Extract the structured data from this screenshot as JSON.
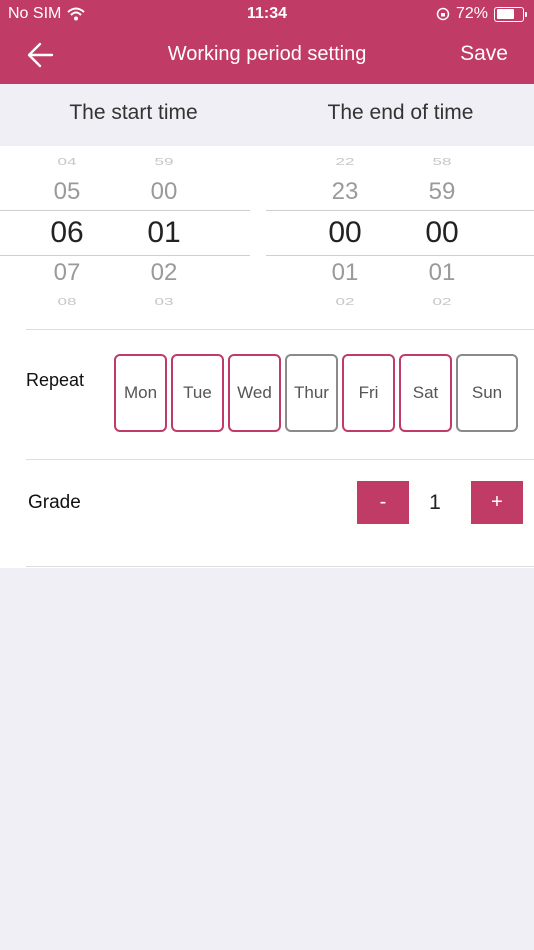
{
  "status": {
    "carrier": "No SIM",
    "time": "11:34",
    "battery": "72%",
    "battery_level": 0.72
  },
  "nav": {
    "title": "Working period setting",
    "save": "Save"
  },
  "time_header": {
    "start": "The start time",
    "end": "The end of time"
  },
  "start_time": {
    "hours": [
      "04",
      "05",
      "06",
      "07",
      "08"
    ],
    "minutes": [
      "59",
      "00",
      "01",
      "02",
      "03"
    ]
  },
  "end_time": {
    "hours": [
      "22",
      "23",
      "00",
      "01",
      "02"
    ],
    "minutes": [
      "58",
      "59",
      "00",
      "01",
      "02"
    ]
  },
  "repeat": {
    "label": "Repeat",
    "days": [
      {
        "label": "Mon",
        "selected": true
      },
      {
        "label": "Tue",
        "selected": true
      },
      {
        "label": "Wed",
        "selected": true
      },
      {
        "label": "Thur",
        "selected": false
      },
      {
        "label": "Fri",
        "selected": true
      },
      {
        "label": "Sat",
        "selected": true
      },
      {
        "label": "Sun",
        "selected": false
      }
    ]
  },
  "grade": {
    "label": "Grade",
    "minus": "-",
    "value": "1",
    "plus": "+"
  },
  "colors": {
    "accent": "#c03b66",
    "unselected_border": "#8a8a8a",
    "background": "#f0eff5"
  }
}
